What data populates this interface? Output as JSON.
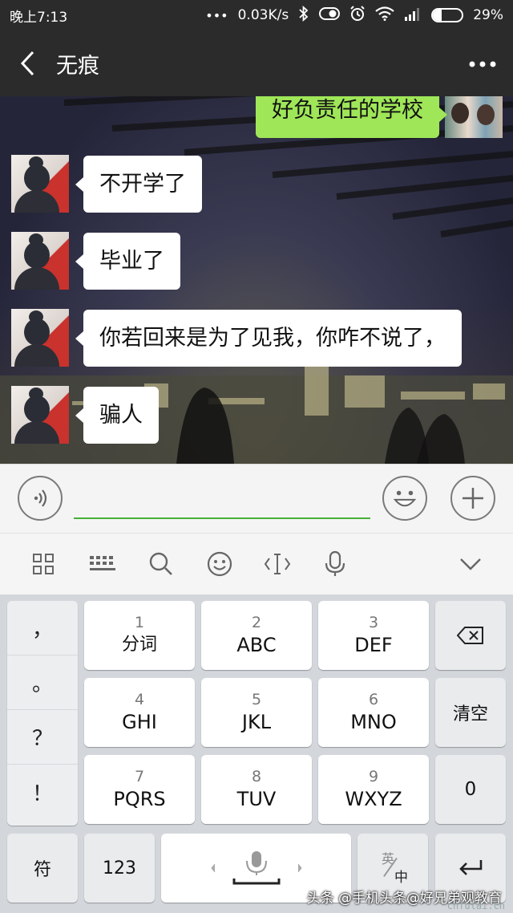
{
  "status_bar": {
    "time": "晚上7:13",
    "network_speed": "0.03K/s",
    "battery": "29%",
    "battery_level": 0.29
  },
  "header": {
    "title": "无痕"
  },
  "chat": {
    "sent": [
      {
        "text": "好负责任的学校"
      }
    ],
    "received": [
      {
        "text": "不开学了"
      },
      {
        "text": "毕业了"
      },
      {
        "text": "你若回来是为了见我，你咋不说了，"
      },
      {
        "text": "骗人"
      }
    ]
  },
  "keyboard": {
    "punctuation": [
      "，",
      "。",
      "？",
      "！"
    ],
    "keys": [
      {
        "num": "1",
        "letters": "分词"
      },
      {
        "num": "2",
        "letters": "ABC"
      },
      {
        "num": "3",
        "letters": "DEF"
      },
      {
        "num": "4",
        "letters": "GHI"
      },
      {
        "num": "5",
        "letters": "JKL"
      },
      {
        "num": "6",
        "letters": "MNO"
      },
      {
        "num": "7",
        "letters": "PQRS"
      },
      {
        "num": "8",
        "letters": "TUV"
      },
      {
        "num": "9",
        "letters": "WXYZ"
      }
    ],
    "clear_label": "清空",
    "zero_label": "0",
    "symbol_label": "符",
    "num_label": "123",
    "lang_en": "英",
    "lang_zh": "中"
  },
  "watermark": "头条 @手机头条@好兄弟观教育",
  "watermark_url": "cnfulai.cn"
}
